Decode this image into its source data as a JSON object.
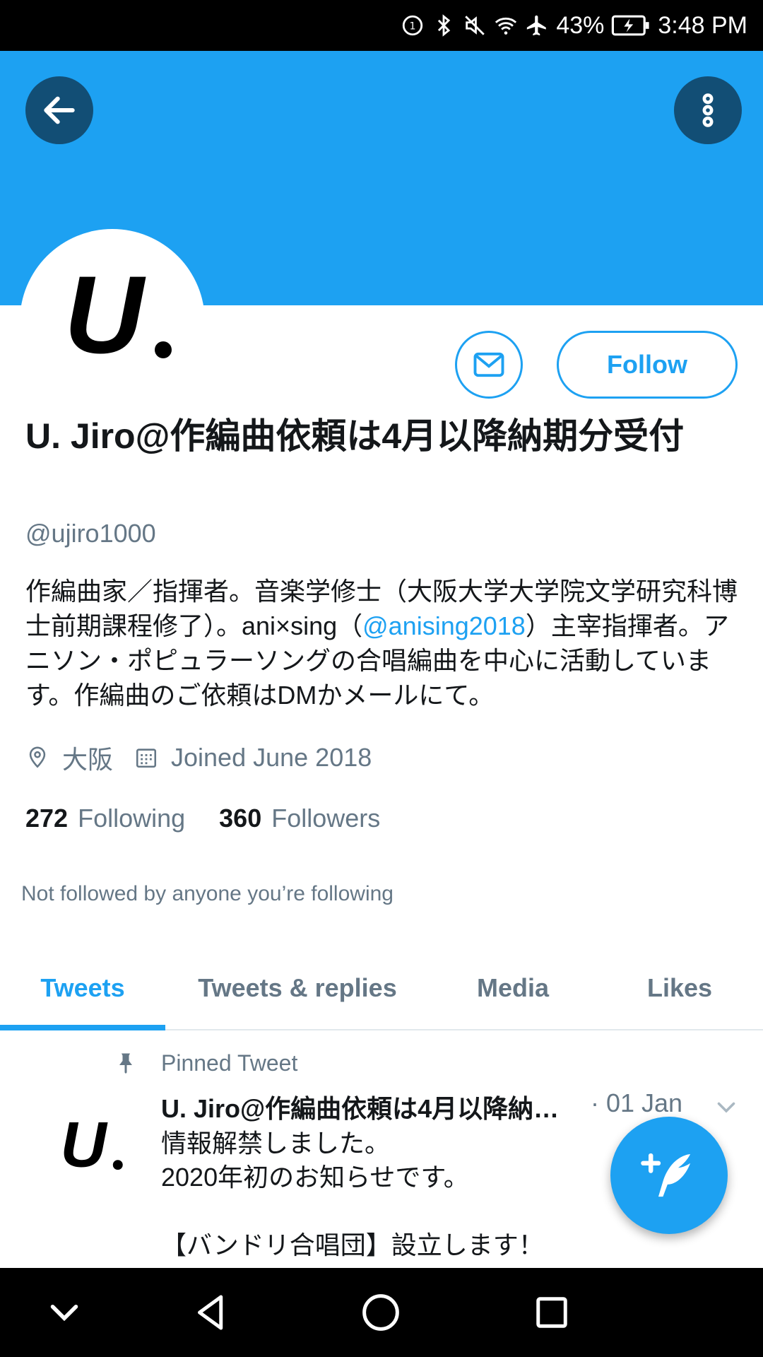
{
  "status_bar": {
    "battery": "43%",
    "time": "3:48 PM",
    "icons": [
      "data-saver-icon",
      "bluetooth-icon",
      "mute-icon",
      "wifi-icon",
      "airplane-icon",
      "battery-charging-icon"
    ]
  },
  "header": {
    "back_icon": "arrow-left-icon",
    "more_icon": "more-vertical-icon",
    "banner_color": "#1da1f2"
  },
  "profile": {
    "avatar_text": "U.",
    "message_icon": "mail-icon",
    "follow_label": "Follow",
    "name": "U. Jiro@作編曲依頼は4月以降納期分受付",
    "handle": "@ujiro1000",
    "bio_part1": "作編曲家／指揮者。音楽学修士（大阪大学大学院文学研究科博士前期課程修了）。ani×sing（",
    "bio_mention": "@anising2018",
    "bio_part2": "）主宰指揮者。アニソン・ポピュラーソングの合唱編曲を中心に活動しています。作編曲のご依頼はDMかメールにて。",
    "location": "大阪",
    "joined": "Joined June 2018",
    "following_count": "272",
    "following_label": "Following",
    "followers_count": "360",
    "followers_label": "Followers",
    "not_followed": "Not followed by anyone you’re following"
  },
  "tabs": [
    {
      "label": "Tweets",
      "active": true
    },
    {
      "label": "Tweets & replies",
      "active": false
    },
    {
      "label": "Media",
      "active": false
    },
    {
      "label": "Likes",
      "active": false
    }
  ],
  "tweet": {
    "pinned_label": "Pinned Tweet",
    "author": "U. Jiro@作編曲依頼は4月以降納…",
    "date": "· 01 Jan",
    "text": "情報解禁しました。\n2020年初のお知らせです。\n\n【バンドリ合唱団】設立します！"
  },
  "fab_icon": "compose-tweet-icon",
  "nav_bar": {
    "icons": [
      "chevron-down-icon",
      "back-triangle-icon",
      "home-circle-icon",
      "recents-square-icon"
    ]
  },
  "colors": {
    "accent": "#1da1f2",
    "dark_button": "#124e75",
    "secondary_text": "#657786"
  }
}
